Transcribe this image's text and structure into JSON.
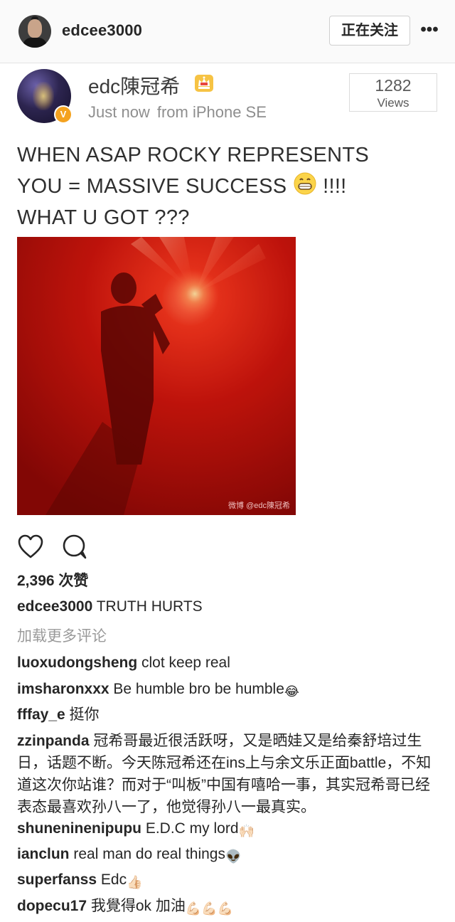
{
  "header": {
    "username": "edcee3000",
    "follow_label": "正在关注",
    "more_label": "•••"
  },
  "post": {
    "author_name": "edc陳冠希",
    "time": "Just now",
    "source": "from iPhone SE",
    "views_count": "1282",
    "views_label": "Views",
    "text_line1": "WHEN ASAP ROCKY REPRESENTS",
    "text_line2a": "YOU = MASSIVE SUCCESS",
    "text_line2b": "!!!!",
    "text_line3": "WHAT U GOT ???",
    "watermark": "微博 @edc陳冠希"
  },
  "engagement": {
    "likes": "2,396 次赞"
  },
  "caption": {
    "username": "edcee3000",
    "text": "TRUTH HURTS"
  },
  "load_more_label": "加载更多评论",
  "comments": [
    {
      "username": "luoxudongsheng",
      "text": "clot keep real",
      "emoji": ""
    },
    {
      "username": "imsharonxxx",
      "text": "Be humble bro be humble",
      "emoji": "😂"
    },
    {
      "username": "fffay_e",
      "text": "挺你",
      "emoji": ""
    },
    {
      "username": "zzinpanda",
      "text": "冠希哥最近很活跃呀，又是晒娃又是给秦舒培过生日，话题不断。今天陈冠希还在ins上与余文乐正面battle，不知道这次你站谁？而对于“叫板”中国有嘻哈一事，其实冠希哥已经表态最喜欢孙八一了，他觉得孙八一最真实。",
      "emoji": ""
    },
    {
      "username": "shuneninenipupu",
      "text": "E.D.C my lord",
      "emoji": "🙌🏻"
    },
    {
      "username": "ianclun",
      "text": "real man do real things",
      "emoji": "👽"
    },
    {
      "username": "superfanss",
      "text": "Edc",
      "emoji": "👍🏻"
    },
    {
      "username": "dopecu17",
      "text": "我覺得ok 加油",
      "emoji": "💪🏻💪🏻💪🏻"
    }
  ],
  "icons": {
    "verified_badge": "V",
    "accent_color": "#f4a21f"
  }
}
